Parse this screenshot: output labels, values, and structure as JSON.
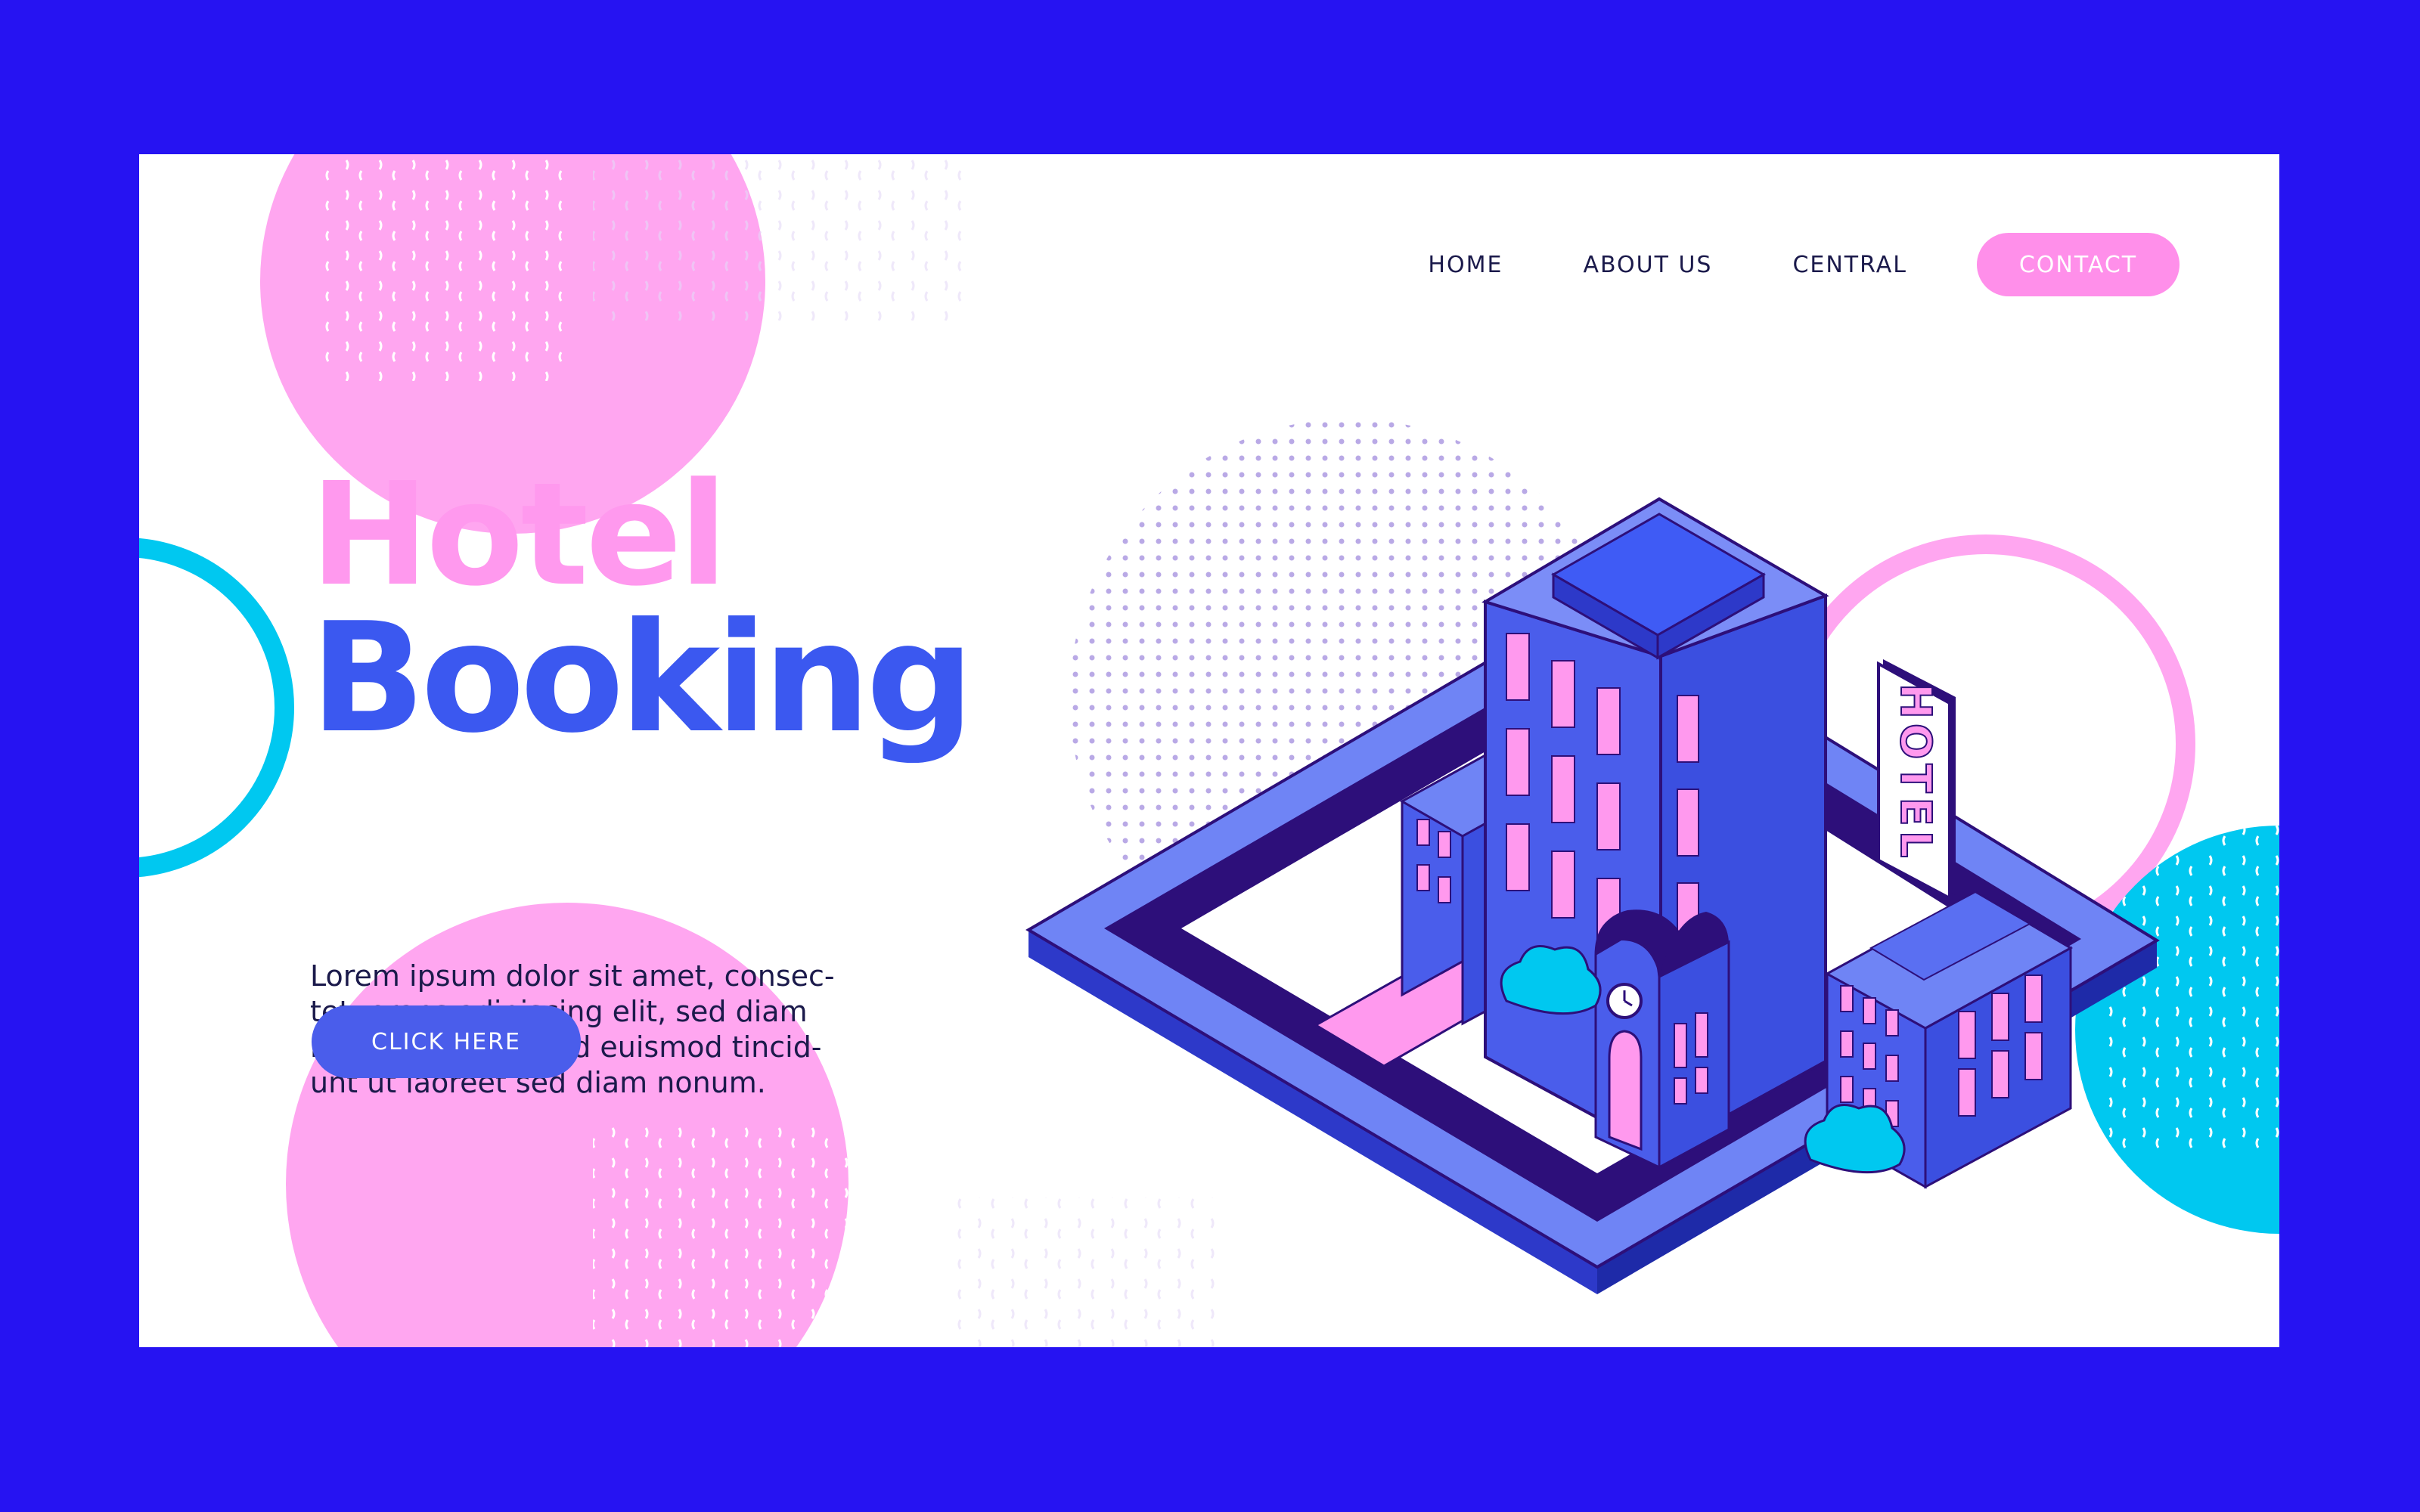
{
  "nav": {
    "items": [
      {
        "label": "HOME"
      },
      {
        "label": "ABOUT US"
      },
      {
        "label": "CENTRAL"
      }
    ],
    "contact_label": "CONTACT"
  },
  "hero": {
    "title_line1": "Hotel",
    "title_line2": "Booking",
    "body": "Lorem ipsum dolor sit amet, consec-\ntetuerans adipiscing elit, sed diam\nnonummy nibhmod euismod tincid-\nunt ut laoreet sed diam nonum.",
    "cta_label": "CLICK HERE"
  },
  "illustration": {
    "sign_text": "HOTEL"
  },
  "colors": {
    "background": "#2613F2",
    "card": "#FFFFFF",
    "pink": "#FF99EE",
    "blue": "#3B58F0",
    "cyan": "#00C8F0",
    "navy": "#1B1A4B",
    "building": "#4A5DEB",
    "building_dark": "#2D0F7A"
  },
  "icons": [
    "clock-icon"
  ]
}
